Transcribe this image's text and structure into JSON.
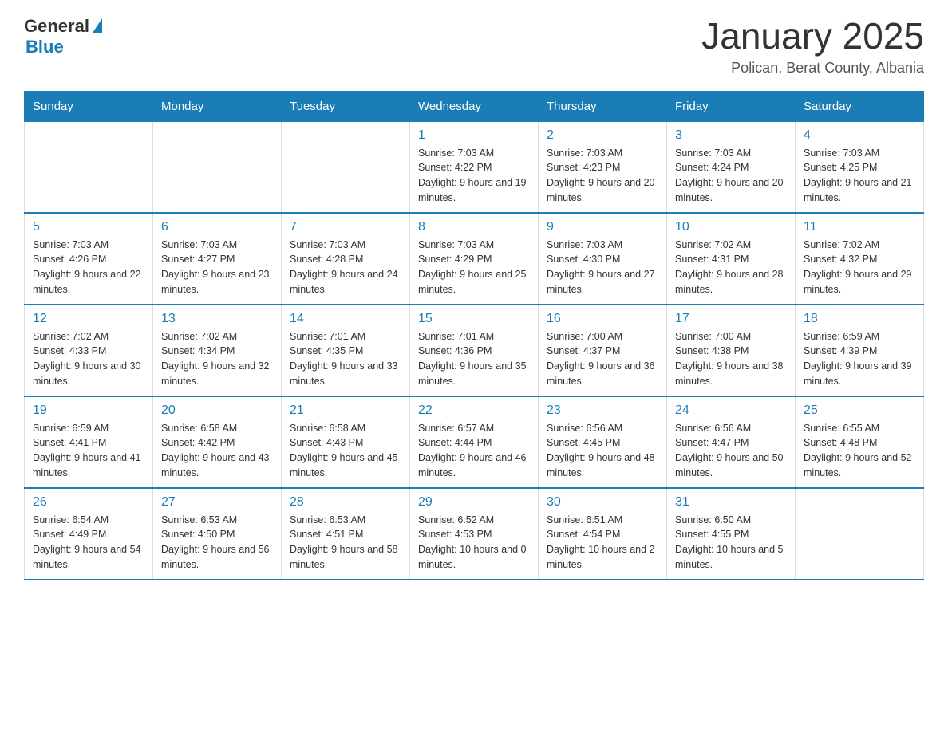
{
  "logo": {
    "general": "General",
    "blue": "Blue"
  },
  "title": "January 2025",
  "subtitle": "Polican, Berat County, Albania",
  "days_of_week": [
    "Sunday",
    "Monday",
    "Tuesday",
    "Wednesday",
    "Thursday",
    "Friday",
    "Saturday"
  ],
  "weeks": [
    [
      {
        "day": "",
        "info": ""
      },
      {
        "day": "",
        "info": ""
      },
      {
        "day": "",
        "info": ""
      },
      {
        "day": "1",
        "info": "Sunrise: 7:03 AM\nSunset: 4:22 PM\nDaylight: 9 hours and 19 minutes."
      },
      {
        "day": "2",
        "info": "Sunrise: 7:03 AM\nSunset: 4:23 PM\nDaylight: 9 hours and 20 minutes."
      },
      {
        "day": "3",
        "info": "Sunrise: 7:03 AM\nSunset: 4:24 PM\nDaylight: 9 hours and 20 minutes."
      },
      {
        "day": "4",
        "info": "Sunrise: 7:03 AM\nSunset: 4:25 PM\nDaylight: 9 hours and 21 minutes."
      }
    ],
    [
      {
        "day": "5",
        "info": "Sunrise: 7:03 AM\nSunset: 4:26 PM\nDaylight: 9 hours and 22 minutes."
      },
      {
        "day": "6",
        "info": "Sunrise: 7:03 AM\nSunset: 4:27 PM\nDaylight: 9 hours and 23 minutes."
      },
      {
        "day": "7",
        "info": "Sunrise: 7:03 AM\nSunset: 4:28 PM\nDaylight: 9 hours and 24 minutes."
      },
      {
        "day": "8",
        "info": "Sunrise: 7:03 AM\nSunset: 4:29 PM\nDaylight: 9 hours and 25 minutes."
      },
      {
        "day": "9",
        "info": "Sunrise: 7:03 AM\nSunset: 4:30 PM\nDaylight: 9 hours and 27 minutes."
      },
      {
        "day": "10",
        "info": "Sunrise: 7:02 AM\nSunset: 4:31 PM\nDaylight: 9 hours and 28 minutes."
      },
      {
        "day": "11",
        "info": "Sunrise: 7:02 AM\nSunset: 4:32 PM\nDaylight: 9 hours and 29 minutes."
      }
    ],
    [
      {
        "day": "12",
        "info": "Sunrise: 7:02 AM\nSunset: 4:33 PM\nDaylight: 9 hours and 30 minutes."
      },
      {
        "day": "13",
        "info": "Sunrise: 7:02 AM\nSunset: 4:34 PM\nDaylight: 9 hours and 32 minutes."
      },
      {
        "day": "14",
        "info": "Sunrise: 7:01 AM\nSunset: 4:35 PM\nDaylight: 9 hours and 33 minutes."
      },
      {
        "day": "15",
        "info": "Sunrise: 7:01 AM\nSunset: 4:36 PM\nDaylight: 9 hours and 35 minutes."
      },
      {
        "day": "16",
        "info": "Sunrise: 7:00 AM\nSunset: 4:37 PM\nDaylight: 9 hours and 36 minutes."
      },
      {
        "day": "17",
        "info": "Sunrise: 7:00 AM\nSunset: 4:38 PM\nDaylight: 9 hours and 38 minutes."
      },
      {
        "day": "18",
        "info": "Sunrise: 6:59 AM\nSunset: 4:39 PM\nDaylight: 9 hours and 39 minutes."
      }
    ],
    [
      {
        "day": "19",
        "info": "Sunrise: 6:59 AM\nSunset: 4:41 PM\nDaylight: 9 hours and 41 minutes."
      },
      {
        "day": "20",
        "info": "Sunrise: 6:58 AM\nSunset: 4:42 PM\nDaylight: 9 hours and 43 minutes."
      },
      {
        "day": "21",
        "info": "Sunrise: 6:58 AM\nSunset: 4:43 PM\nDaylight: 9 hours and 45 minutes."
      },
      {
        "day": "22",
        "info": "Sunrise: 6:57 AM\nSunset: 4:44 PM\nDaylight: 9 hours and 46 minutes."
      },
      {
        "day": "23",
        "info": "Sunrise: 6:56 AM\nSunset: 4:45 PM\nDaylight: 9 hours and 48 minutes."
      },
      {
        "day": "24",
        "info": "Sunrise: 6:56 AM\nSunset: 4:47 PM\nDaylight: 9 hours and 50 minutes."
      },
      {
        "day": "25",
        "info": "Sunrise: 6:55 AM\nSunset: 4:48 PM\nDaylight: 9 hours and 52 minutes."
      }
    ],
    [
      {
        "day": "26",
        "info": "Sunrise: 6:54 AM\nSunset: 4:49 PM\nDaylight: 9 hours and 54 minutes."
      },
      {
        "day": "27",
        "info": "Sunrise: 6:53 AM\nSunset: 4:50 PM\nDaylight: 9 hours and 56 minutes."
      },
      {
        "day": "28",
        "info": "Sunrise: 6:53 AM\nSunset: 4:51 PM\nDaylight: 9 hours and 58 minutes."
      },
      {
        "day": "29",
        "info": "Sunrise: 6:52 AM\nSunset: 4:53 PM\nDaylight: 10 hours and 0 minutes."
      },
      {
        "day": "30",
        "info": "Sunrise: 6:51 AM\nSunset: 4:54 PM\nDaylight: 10 hours and 2 minutes."
      },
      {
        "day": "31",
        "info": "Sunrise: 6:50 AM\nSunset: 4:55 PM\nDaylight: 10 hours and 5 minutes."
      },
      {
        "day": "",
        "info": ""
      }
    ]
  ]
}
